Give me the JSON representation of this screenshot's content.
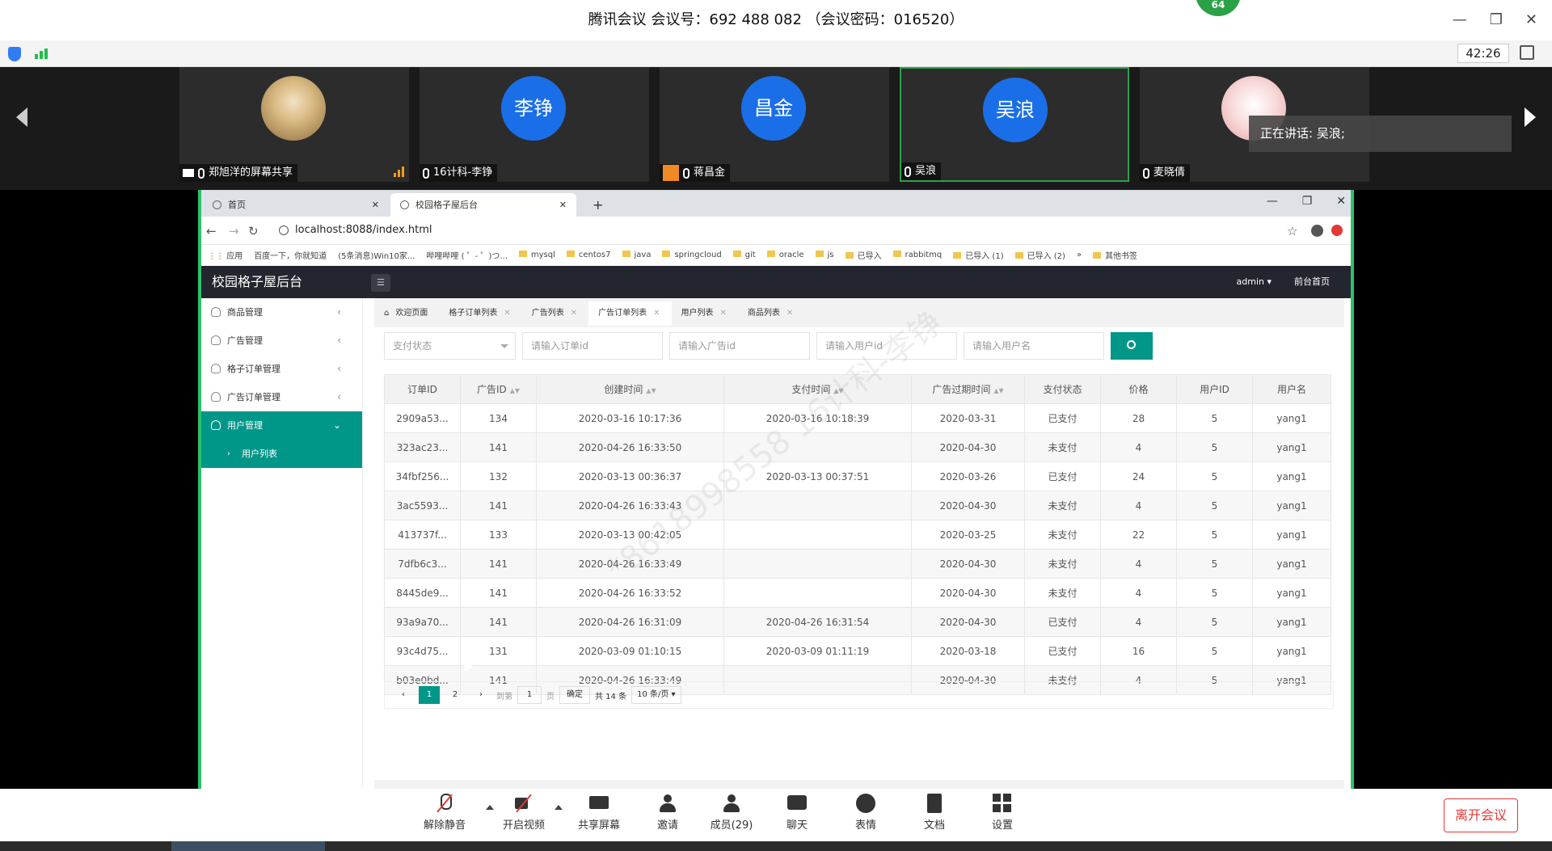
{
  "meeting": {
    "title": "腾讯会议 会议号：692 488 082 （会议密码：016520）",
    "viewer_count": "64",
    "timer": "42:26",
    "speaking": "正在讲话: 吴浪;",
    "participants": [
      {
        "name": "郑旭洋的屏幕共享",
        "avatar_text": ""
      },
      {
        "name": "16计科-李铮",
        "avatar_text": "李铮"
      },
      {
        "name": "蒋昌金",
        "avatar_text": "昌金"
      },
      {
        "name": "吴浪",
        "avatar_text": "吴浪"
      },
      {
        "name": "麦晓倩",
        "avatar_text": ""
      }
    ],
    "controls": [
      "解除静音",
      "开启视频",
      "共享屏幕",
      "邀请",
      "成员(29)",
      "聊天",
      "表情",
      "文档",
      "设置"
    ],
    "leave": "离开会议",
    "watermark": "*8618998558 16计科-李铮"
  },
  "browser": {
    "tabs": [
      "首页",
      "校园格子屋后台"
    ],
    "new_tab": "+",
    "url": "localhost:8088/index.html",
    "bookmarks": [
      "应用",
      "百度一下，你就知道",
      "(5条消息)Win10家...",
      "哔哩哔哩 ( ゜- ゜)つ...",
      "mysql",
      "centos7",
      "java",
      "springcloud",
      "git",
      "oracle",
      "js",
      "已导入",
      "rabbitmq",
      "已导入 (1)",
      "已导入 (2)",
      "»",
      "其他书签"
    ]
  },
  "app": {
    "title": "校园格子屋后台",
    "user": "admin",
    "front_link": "前台首页",
    "menu": [
      {
        "label": "商品管理"
      },
      {
        "label": "广告管理"
      },
      {
        "label": "格子订单管理"
      },
      {
        "label": "广告订单管理"
      },
      {
        "label": "用户管理"
      }
    ],
    "submenu": "用户列表",
    "page_tabs": [
      "欢迎页面",
      "格子订单列表",
      "广告列表",
      "广告订单列表",
      "用户列表",
      "商品列表"
    ],
    "filters": {
      "status": "支付状态",
      "order_id": "请输入订单id",
      "ad_id": "请输入广告id",
      "user_id": "请输入用户id",
      "username": "请输入用户名"
    },
    "columns": [
      "订单ID",
      "广告ID",
      "创建时间",
      "支付时间",
      "广告过期时间",
      "支付状态",
      "价格",
      "用户ID",
      "用户名"
    ],
    "rows": [
      [
        "2909a53...",
        "134",
        "2020-03-16 10:17:36",
        "2020-03-16 10:18:39",
        "2020-03-31",
        "已支付",
        "28",
        "5",
        "yang1"
      ],
      [
        "323ac23...",
        "141",
        "2020-04-26 16:33:50",
        "",
        "2020-04-30",
        "未支付",
        "4",
        "5",
        "yang1"
      ],
      [
        "34fbf256...",
        "132",
        "2020-03-13 00:36:37",
        "2020-03-13 00:37:51",
        "2020-03-26",
        "已支付",
        "24",
        "5",
        "yang1"
      ],
      [
        "3ac5593...",
        "141",
        "2020-04-26 16:33:43",
        "",
        "2020-04-30",
        "未支付",
        "4",
        "5",
        "yang1"
      ],
      [
        "413737f...",
        "133",
        "2020-03-13 00:42:05",
        "",
        "2020-03-25",
        "未支付",
        "22",
        "5",
        "yang1"
      ],
      [
        "7dfb6c3...",
        "141",
        "2020-04-26 16:33:49",
        "",
        "2020-04-30",
        "未支付",
        "4",
        "5",
        "yang1"
      ],
      [
        "8445de9...",
        "141",
        "2020-04-26 16:33:52",
        "",
        "2020-04-30",
        "未支付",
        "4",
        "5",
        "yang1"
      ],
      [
        "93a9a70...",
        "141",
        "2020-04-26 16:31:09",
        "2020-04-26 16:31:54",
        "2020-04-30",
        "已支付",
        "4",
        "5",
        "yang1"
      ],
      [
        "93c4d75...",
        "131",
        "2020-03-09 01:10:15",
        "2020-03-09 01:11:19",
        "2020-03-18",
        "已支付",
        "16",
        "5",
        "yang1"
      ],
      [
        "b03e0bd...",
        "141",
        "2020-04-26 16:33:49",
        "",
        "2020-04-30",
        "未支付",
        "4",
        "5",
        "yang1"
      ]
    ],
    "pager": {
      "prev": "‹",
      "next": "›",
      "page1": "1",
      "page2": "2",
      "goto": "到第",
      "goto_value": "1",
      "page_unit": "页",
      "confirm": "确定",
      "total": "共 14 条",
      "size": "10 条/页"
    }
  }
}
